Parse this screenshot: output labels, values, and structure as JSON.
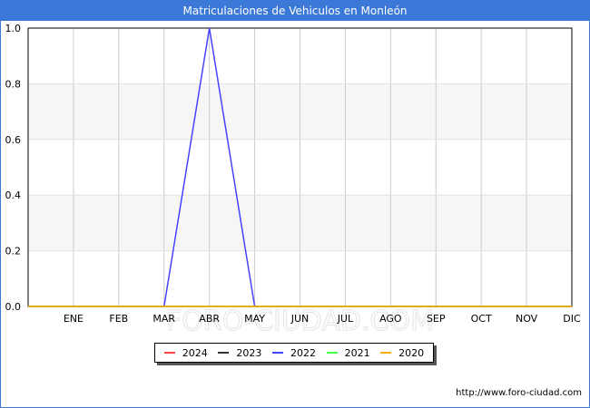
{
  "chart_data": {
    "type": "line",
    "title": "Matriculaciones de Vehiculos en Monleón",
    "categories": [
      "",
      "ENE",
      "FEB",
      "MAR",
      "ABR",
      "MAY",
      "JUN",
      "JUL",
      "AGO",
      "SEP",
      "OCT",
      "NOV",
      "DIC"
    ],
    "yticks": [
      "0.0",
      "0.2",
      "0.4",
      "0.6",
      "0.8",
      "1.0"
    ],
    "ylim": [
      0,
      1
    ],
    "grid": true,
    "legend_position": "bottom",
    "series": [
      {
        "name": "2024",
        "color": "#ff4444",
        "values": [
          0,
          0,
          0,
          0,
          0,
          0,
          0,
          0,
          0,
          0,
          0,
          0,
          0
        ]
      },
      {
        "name": "2023",
        "color": "#333333",
        "values": [
          0,
          0,
          0,
          0,
          0,
          0,
          0,
          0,
          0,
          0,
          0,
          0,
          0
        ]
      },
      {
        "name": "2022",
        "color": "#4444ff",
        "values": [
          0,
          0,
          0,
          0,
          1,
          0,
          0,
          0,
          0,
          0,
          0,
          0,
          0
        ]
      },
      {
        "name": "2021",
        "color": "#44ff44",
        "values": [
          0,
          0,
          0,
          0,
          0,
          0,
          0,
          0,
          0,
          0,
          0,
          0,
          0
        ]
      },
      {
        "name": "2020",
        "color": "#ffaa00",
        "values": [
          0,
          0,
          0,
          0,
          0,
          0,
          0,
          0,
          0,
          0,
          0,
          0,
          0
        ]
      }
    ],
    "watermark": "FORO-CIUDAD.COM",
    "source": "http://www.foro-ciudad.com"
  }
}
